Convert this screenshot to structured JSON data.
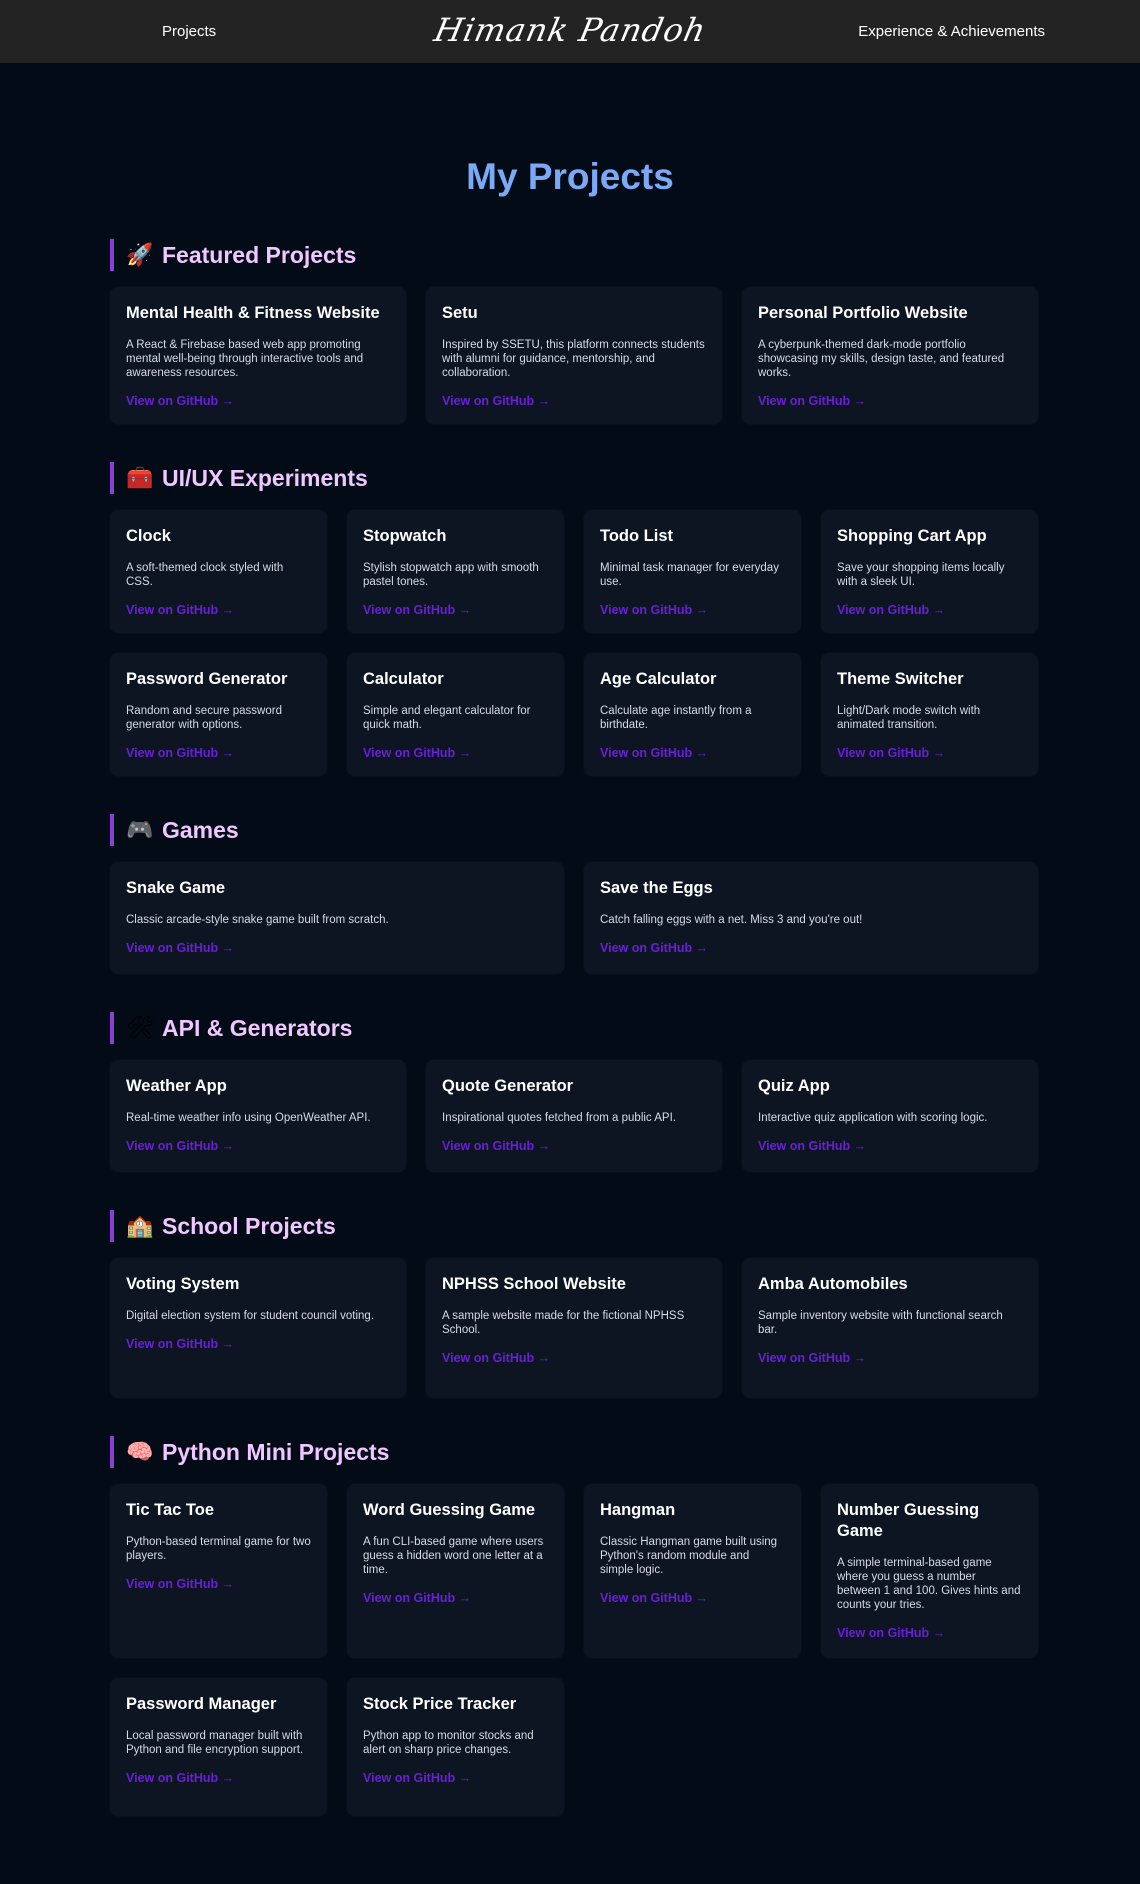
{
  "nav": {
    "projects": "Projects",
    "logo": "Himank Pandoh",
    "experience": "Experience & Achievements"
  },
  "page_title": "My Projects",
  "link_label": "View on GitHub →",
  "colors": {
    "background": "#030b17",
    "navbar": "#232323",
    "title": "#7aaaf5",
    "section_title": "#f0c7ff",
    "section_bar": "#8b3fd9",
    "card": "#0d1522",
    "link": "#6a1fd6"
  },
  "sections": [
    {
      "icon": "🚀",
      "icon_name": "rocket-icon",
      "title": "Featured Projects",
      "cards": [
        {
          "title": "Mental Health & Fitness Website",
          "desc": "A React & Firebase based web app promoting mental well-being through interactive tools and awareness resources."
        },
        {
          "title": "Setu",
          "desc": "Inspired by SSETU, this platform connects students with alumni for guidance, mentorship, and collaboration."
        },
        {
          "title": "Personal Portfolio Website",
          "desc": "A cyberpunk-themed dark-mode portfolio showcasing my skills, design taste, and featured works."
        }
      ]
    },
    {
      "icon": "🧰",
      "icon_name": "toolbox-icon",
      "title": "UI/UX Experiments",
      "cards": [
        {
          "title": "Clock",
          "desc": "A soft-themed clock styled with CSS."
        },
        {
          "title": "Stopwatch",
          "desc": "Stylish stopwatch app with smooth pastel tones."
        },
        {
          "title": "Todo List",
          "desc": "Minimal task manager for everyday use."
        },
        {
          "title": "Shopping Cart App",
          "desc": "Save your shopping items locally with a sleek UI."
        },
        {
          "title": "Password Generator",
          "desc": "Random and secure password generator with options."
        },
        {
          "title": "Calculator",
          "desc": "Simple and elegant calculator for quick math."
        },
        {
          "title": "Age Calculator",
          "desc": "Calculate age instantly from a birthdate."
        },
        {
          "title": "Theme Switcher",
          "desc": "Light/Dark mode switch with animated transition."
        }
      ]
    },
    {
      "icon": "🎮",
      "icon_name": "gamepad-icon",
      "title": "Games",
      "cards": [
        {
          "title": "Snake Game",
          "desc": "Classic arcade-style snake game built from scratch."
        },
        {
          "title": "Save the Eggs",
          "desc": "Catch falling eggs with a net. Miss 3 and you're out!"
        }
      ]
    },
    {
      "icon": "🛠",
      "icon_name": "tools-icon",
      "title": "API & Generators",
      "cards": [
        {
          "title": "Weather App",
          "desc": "Real-time weather info using OpenWeather API."
        },
        {
          "title": "Quote Generator",
          "desc": "Inspirational quotes fetched from a public API."
        },
        {
          "title": "Quiz App",
          "desc": "Interactive quiz application with scoring logic."
        }
      ]
    },
    {
      "icon": "🏫",
      "icon_name": "school-icon",
      "title": "School Projects",
      "cards": [
        {
          "title": "Voting System",
          "desc": "Digital election system for student council voting."
        },
        {
          "title": "NPHSS School Website",
          "desc": "A sample website made for the fictional NPHSS School."
        },
        {
          "title": "Amba Automobiles",
          "desc": "Sample inventory website with functional search bar."
        }
      ]
    },
    {
      "icon": "🧠",
      "icon_name": "brain-icon",
      "title": "Python Mini Projects",
      "cards": [
        {
          "title": "Tic Tac Toe",
          "desc": "Python-based terminal game for two players."
        },
        {
          "title": "Word Guessing Game",
          "desc": "A fun CLI-based game where users guess a hidden word one letter at a time."
        },
        {
          "title": "Hangman",
          "desc": "Classic Hangman game built using Python's random module and simple logic."
        },
        {
          "title": "Number Guessing Game",
          "desc": "A simple terminal-based game where you guess a number between 1 and 100. Gives hints and counts your tries."
        },
        {
          "title": "Password Manager",
          "desc": "Local password manager built with Python and file encryption support."
        },
        {
          "title": "Stock Price Tracker",
          "desc": "Python app to monitor stocks and alert on sharp price changes."
        }
      ]
    }
  ]
}
